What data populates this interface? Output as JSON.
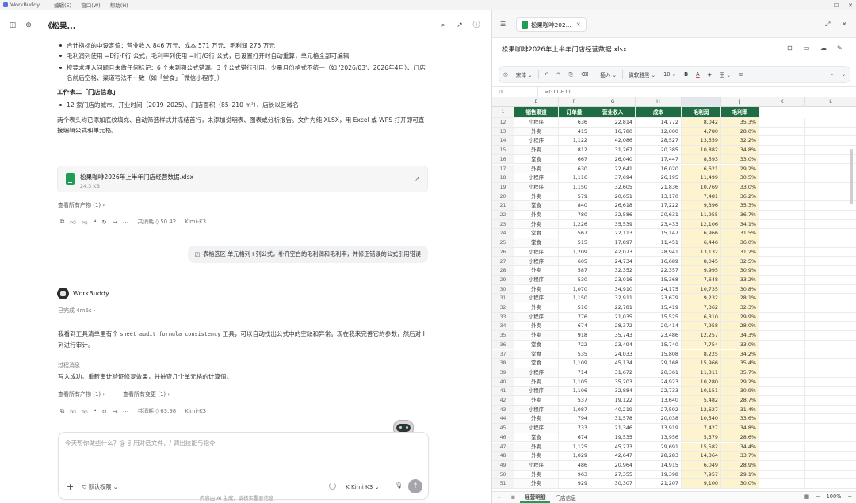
{
  "menubar": {
    "app_name": "WorkBuddy",
    "items": [
      "编辑(E)",
      "窗口(W)",
      "帮助(H)"
    ]
  },
  "chat": {
    "title": "《松果...",
    "bullets_top": [
      "合计指标的中设定值：营业收入 846 万元、成本 571 万元、毛利润 275 万元",
      "毛利润列使用 =E行-F行 公式，毛利率列使用 =I行/G行 公式，已设置打开时自动重算，单元格全部可编辑",
      "按要求埋入问题且未做任何标记：6 个未到期公式错漏、3 个公式错行引用、少量月份格式不统一（如 '2026/03'、2026年4月）、门店名前后空格、渠道写法不一致（如「堂食」「微信小程序」）"
    ],
    "section2_title": "工作表二「门店信息」",
    "section2_bullet": "12 家门店的城市、开业时间（2019–2025）、门店面积（85–210 m²）、店长以区域名",
    "para": "两个表头均已添加底纹填充、自动筛选样式并冻结首行，未添加说明表、图表或分析报告。文件为纯 XLSX，用 Excel 或 WPS 打开即可直接编辑公式和单元格。",
    "file": {
      "name": "松果咖啡2026年上半年门店经营数据.xlsx",
      "size": "24.3 KB"
    },
    "view_all_1": "查看所有产物 (1) ›",
    "meta_1": {
      "credits": "共消耗 ◊ 50.42",
      "model": "Kimi-K3"
    },
    "user_message": "表格选区 单元格列 I 列公式，补齐空白的毛利润和毛利率，并修正错误的公式引用错误",
    "agent": {
      "name": "WorkBuddy",
      "done": "已完成 4m6s ›",
      "reply_prefix": "我看到工具清单里有个 ",
      "reply_code": "sheet audit formula consistency",
      "reply_suffix": " 工具，可以自动找出公式中的空缺和异常。现在我来完善它的参数，然后对 I 列进行审计。",
      "process_label": "过程消息",
      "result": "写入成功。重新审计验证修复效果，并抽查几个单元格的计算值。",
      "view_all": "查看所有产物 (1) ›",
      "view_changes": "查看所有变更 (1) ›",
      "meta": {
        "credits": "共消耗 ◊ 63.98",
        "model": "Kimi-K3"
      }
    },
    "input": {
      "placeholder": "今天帮你做些什么？@ 引用对话文件，/ 调出技能与指令",
      "permission": "默认权限 ⌄",
      "model": "Kimi K3 ⌄",
      "footnote": "内容由 AI 生成，请核实重要信息"
    }
  },
  "sheet": {
    "tab_title": "松果咖啡202...",
    "doc_title": "松果咖啡2026年上半年门店经营数据.xlsx",
    "toolbar": [
      "宋体 ⌄",
      "微软雅黑 ⌄",
      "10 ⌄",
      "B",
      "A",
      "插入 ⌄",
      "田 ⌄"
    ],
    "cell_ref": "I1",
    "formula": "=G11-H11",
    "columns": [
      "E",
      "F",
      "G",
      "H",
      "I",
      "J",
      "K",
      "L"
    ],
    "headers": [
      "销售渠道",
      "订单量",
      "营业收入",
      "成本",
      "毛利润",
      "毛利率"
    ],
    "rows": [
      {
        "n": "12",
        "ch": "小程序",
        "q": "636",
        "r": "22,814",
        "c": "14,772",
        "g": "8,042",
        "m": "35.3%"
      },
      {
        "n": "13",
        "ch": "外卖",
        "q": "415",
        "r": "16,780",
        "c": "12,000",
        "g": "4,780",
        "m": "28.0%"
      },
      {
        "n": "14",
        "ch": "小程序",
        "q": "1,122",
        "r": "42,086",
        "c": "28,527",
        "g": "13,559",
        "m": "32.2%"
      },
      {
        "n": "15",
        "ch": "外卖",
        "q": "812",
        "r": "31,267",
        "c": "20,385",
        "g": "10,882",
        "m": "34.8%"
      },
      {
        "n": "16",
        "ch": "堂食",
        "q": "667",
        "r": "26,040",
        "c": "17,447",
        "g": "8,593",
        "m": "33.0%"
      },
      {
        "n": "17",
        "ch": "外卖",
        "q": "630",
        "r": "22,641",
        "c": "16,020",
        "g": "6,621",
        "m": "29.2%"
      },
      {
        "n": "18",
        "ch": "小程序",
        "q": "1,116",
        "r": "37,694",
        "c": "26,195",
        "g": "11,499",
        "m": "30.5%"
      },
      {
        "n": "19",
        "ch": "小程序",
        "q": "1,150",
        "r": "32,605",
        "c": "21,836",
        "g": "10,769",
        "m": "33.0%"
      },
      {
        "n": "20",
        "ch": "外卖",
        "q": "579",
        "r": "20,651",
        "c": "13,170",
        "g": "7,481",
        "m": "36.2%"
      },
      {
        "n": "21",
        "ch": "堂食",
        "q": "840",
        "r": "26,618",
        "c": "17,222",
        "g": "9,396",
        "m": "35.3%"
      },
      {
        "n": "22",
        "ch": "外卖",
        "q": "780",
        "r": "32,586",
        "c": "20,631",
        "g": "11,955",
        "m": "36.7%"
      },
      {
        "n": "23",
        "ch": "外卖",
        "q": "1,226",
        "r": "35,539",
        "c": "23,433",
        "g": "12,106",
        "m": "34.1%"
      },
      {
        "n": "24",
        "ch": "堂食",
        "q": "567",
        "r": "22,113",
        "c": "15,147",
        "g": "6,966",
        "m": "31.5%"
      },
      {
        "n": "25",
        "ch": "堂食",
        "q": "515",
        "r": "17,897",
        "c": "11,451",
        "g": "6,446",
        "m": "36.0%"
      },
      {
        "n": "26",
        "ch": "小程序",
        "q": "1,209",
        "r": "42,073",
        "c": "28,941",
        "g": "13,132",
        "m": "31.2%"
      },
      {
        "n": "27",
        "ch": "小程序",
        "q": "605",
        "r": "24,734",
        "c": "16,689",
        "g": "8,045",
        "m": "32.5%"
      },
      {
        "n": "28",
        "ch": "外卖",
        "q": "587",
        "r": "32,352",
        "c": "22,357",
        "g": "9,995",
        "m": "30.9%"
      },
      {
        "n": "29",
        "ch": "小程序",
        "q": "530",
        "r": "23,016",
        "c": "15,368",
        "g": "7,648",
        "m": "33.2%"
      },
      {
        "n": "30",
        "ch": "外卖",
        "q": "1,070",
        "r": "34,910",
        "c": "24,175",
        "g": "10,735",
        "m": "30.8%"
      },
      {
        "n": "31",
        "ch": "小程序",
        "q": "1,150",
        "r": "32,911",
        "c": "23,679",
        "g": "9,232",
        "m": "28.1%"
      },
      {
        "n": "32",
        "ch": "外卖",
        "q": "516",
        "r": "22,781",
        "c": "15,419",
        "g": "7,362",
        "m": "32.3%"
      },
      {
        "n": "33",
        "ch": "小程序",
        "q": "776",
        "r": "21,035",
        "c": "15,525",
        "g": "6,310",
        "m": "29.9%"
      },
      {
        "n": "34",
        "ch": "外卖",
        "q": "674",
        "r": "28,372",
        "c": "20,414",
        "g": "7,958",
        "m": "28.0%"
      },
      {
        "n": "35",
        "ch": "外卖",
        "q": "918",
        "r": "35,743",
        "c": "23,486",
        "g": "12,257",
        "m": "34.3%"
      },
      {
        "n": "36",
        "ch": "堂食",
        "q": "722",
        "r": "23,494",
        "c": "15,740",
        "g": "7,754",
        "m": "33.0%"
      },
      {
        "n": "37",
        "ch": "堂食",
        "q": "535",
        "r": "24,033",
        "c": "15,808",
        "g": "8,225",
        "m": "34.2%"
      },
      {
        "n": "38",
        "ch": "堂食",
        "q": "1,109",
        "r": "45,134",
        "c": "29,168",
        "g": "15,966",
        "m": "35.4%"
      },
      {
        "n": "39",
        "ch": "小程序",
        "q": "714",
        "r": "31,672",
        "c": "20,361",
        "g": "11,311",
        "m": "35.7%"
      },
      {
        "n": "40",
        "ch": "外卖",
        "q": "1,105",
        "r": "35,203",
        "c": "24,923",
        "g": "10,280",
        "m": "29.2%"
      },
      {
        "n": "41",
        "ch": "小程序",
        "q": "1,106",
        "r": "32,884",
        "c": "22,733",
        "g": "10,151",
        "m": "30.9%"
      },
      {
        "n": "42",
        "ch": "外卖",
        "q": "537",
        "r": "19,122",
        "c": "13,640",
        "g": "5,482",
        "m": "28.7%"
      },
      {
        "n": "43",
        "ch": "小程序",
        "q": "1,087",
        "r": "40,219",
        "c": "27,592",
        "g": "12,627",
        "m": "31.4%"
      },
      {
        "n": "44",
        "ch": "外卖",
        "q": "794",
        "r": "31,578",
        "c": "20,038",
        "g": "10,540",
        "m": "33.6%"
      },
      {
        "n": "45",
        "ch": "小程序",
        "q": "733",
        "r": "21,346",
        "c": "13,919",
        "g": "7,427",
        "m": "34.8%"
      },
      {
        "n": "46",
        "ch": "堂食",
        "q": "674",
        "r": "19,535",
        "c": "13,956",
        "g": "5,579",
        "m": "28.6%"
      },
      {
        "n": "47",
        "ch": "外卖",
        "q": "1,125",
        "r": "45,273",
        "c": "29,691",
        "g": "15,582",
        "m": "34.4%"
      },
      {
        "n": "48",
        "ch": "外卖",
        "q": "1,029",
        "r": "42,647",
        "c": "28,283",
        "g": "14,364",
        "m": "33.7%"
      },
      {
        "n": "49",
        "ch": "小程序",
        "q": "486",
        "r": "20,964",
        "c": "14,915",
        "g": "6,049",
        "m": "28.9%"
      },
      {
        "n": "50",
        "ch": "外卖",
        "q": "963",
        "r": "27,355",
        "c": "19,398",
        "g": "7,957",
        "m": "29.1%"
      },
      {
        "n": "51",
        "ch": "外卖",
        "q": "929",
        "r": "30,307",
        "c": "21,207",
        "g": "9,100",
        "m": "30.0%"
      }
    ],
    "status": {
      "sheet1": "经营明细",
      "sheet2": "门店信息",
      "zoom": "100%"
    }
  }
}
